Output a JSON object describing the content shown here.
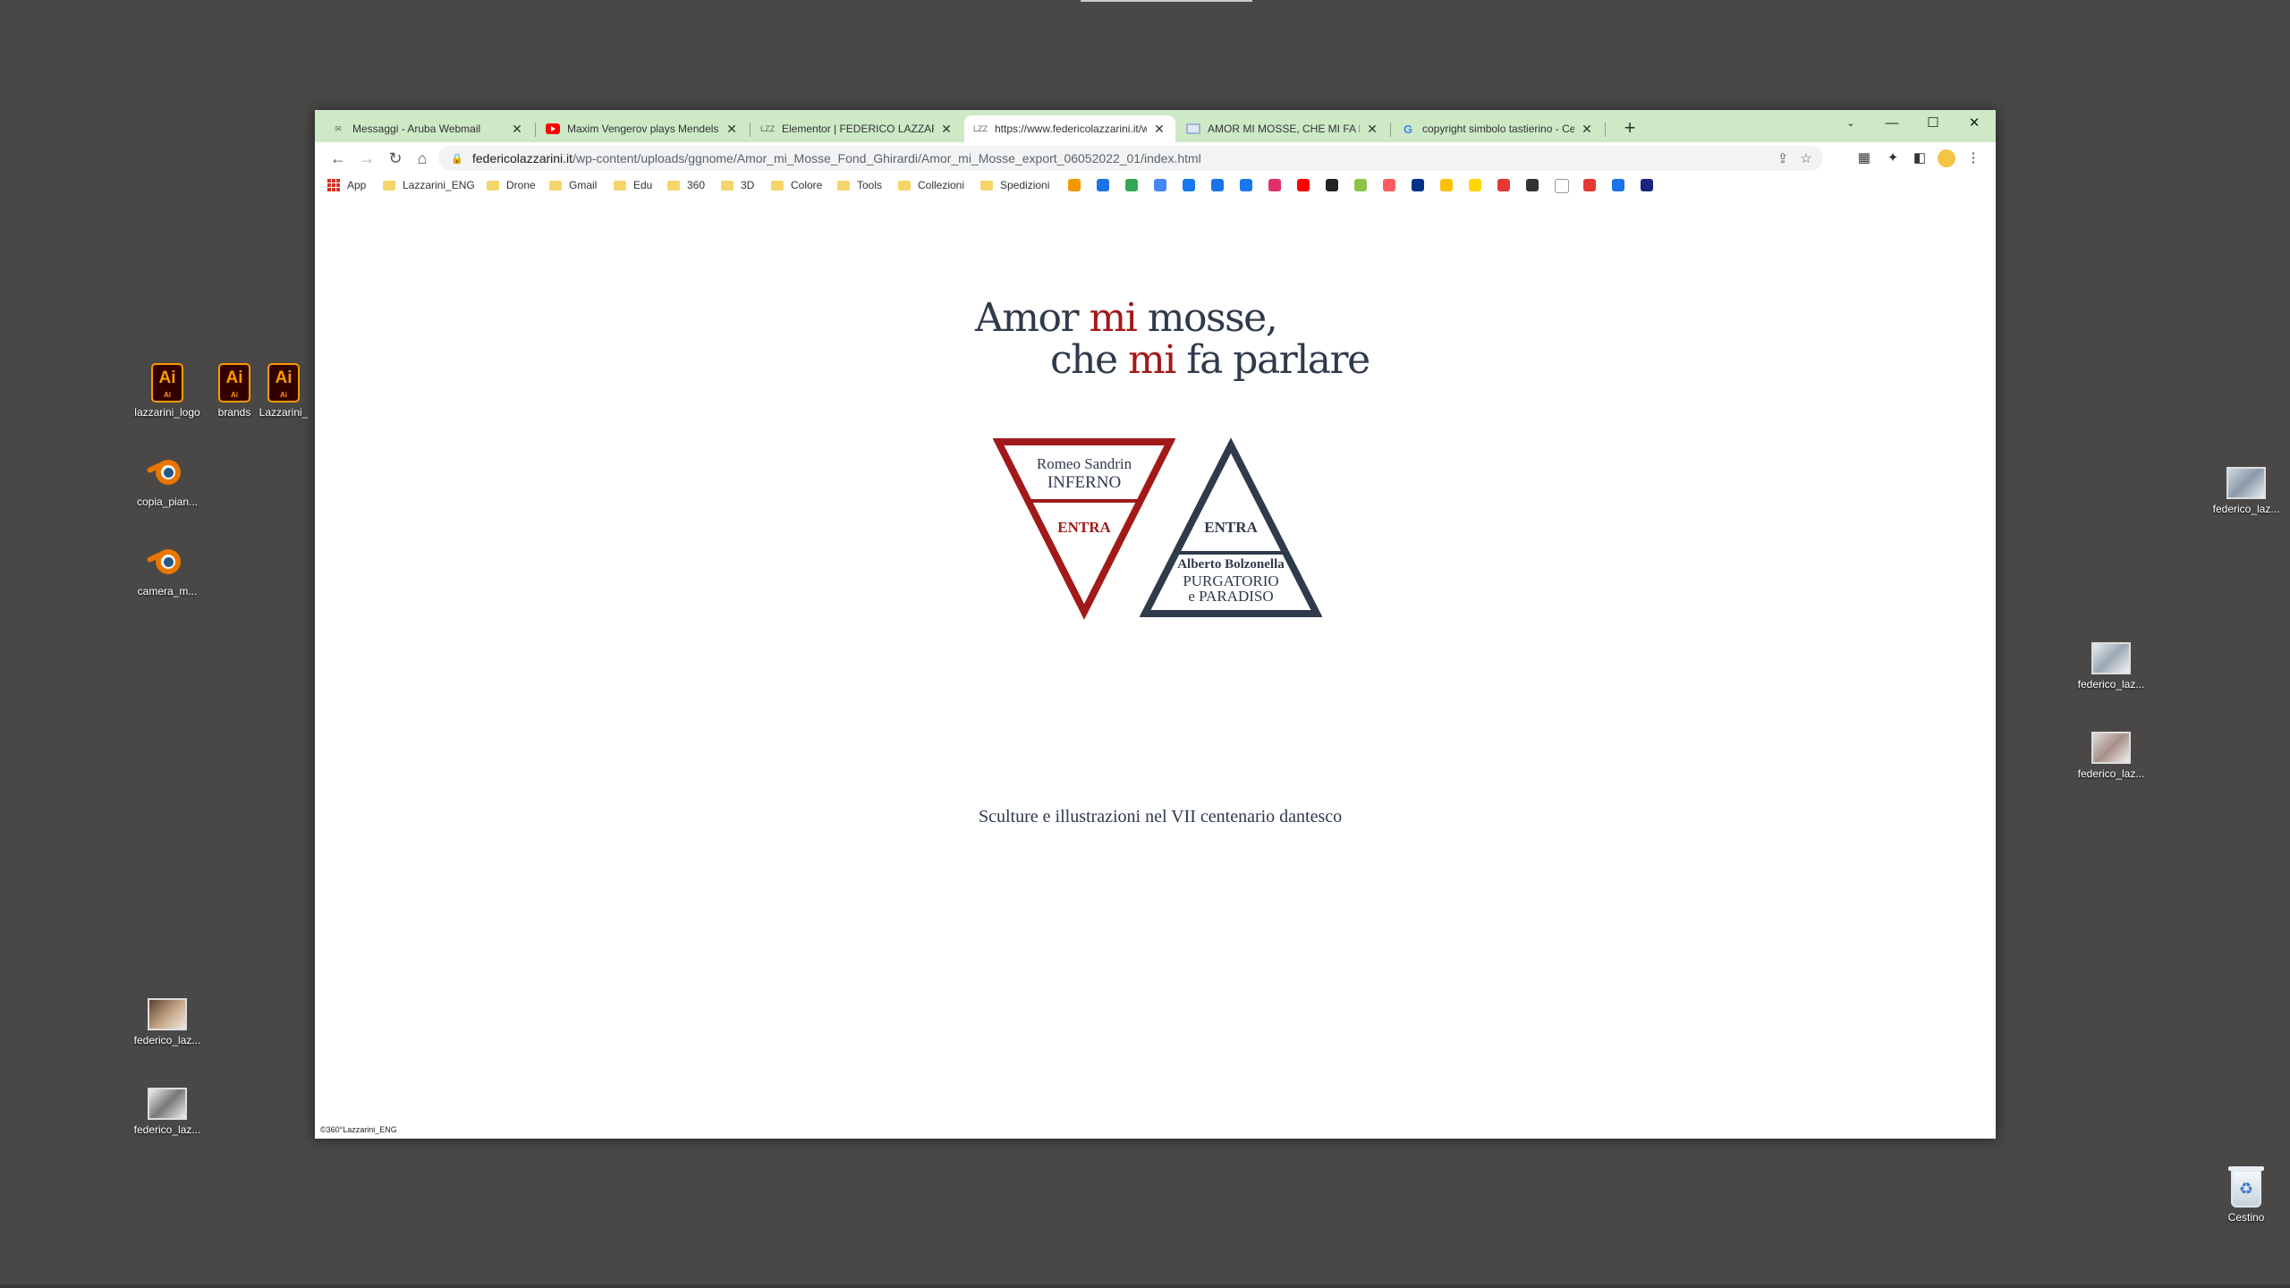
{
  "desktop": {
    "icons_left": [
      {
        "label": "lazzarini_logo",
        "type": "ai"
      },
      {
        "label": "brands",
        "type": "ai"
      },
      {
        "label": "Lazzarini_",
        "type": "ai"
      },
      {
        "label": "copia_pian...",
        "type": "blender"
      },
      {
        "label": "camera_m...",
        "type": "blender"
      },
      {
        "label": "federico_laz...",
        "type": "image"
      },
      {
        "label": "federico_laz...",
        "type": "image"
      }
    ],
    "icons_right": [
      {
        "label": "federico_laz...",
        "type": "image"
      },
      {
        "label": "federico_laz...",
        "type": "image"
      },
      {
        "label": "federico_laz...",
        "type": "image"
      }
    ],
    "recycle_bin": "Cestino",
    "ai_badge": "Ai",
    "ai_small": "Ai"
  },
  "browser": {
    "tabs": [
      {
        "title": "Messaggi - Aruba Webmail",
        "icon": "mail-icon"
      },
      {
        "title": "Maxim Vengerov plays Mendelsso",
        "icon": "youtube-icon"
      },
      {
        "title": "Elementor | FEDERICO LAZZARINI",
        "icon": "lzz-icon"
      },
      {
        "title": "https://www.federicolazzarini.it/w",
        "icon": "lzz-icon"
      },
      {
        "title": "AMOR MI MOSSE, CHE MI FA PA",
        "icon": "image-icon"
      },
      {
        "title": "copyright simbolo tastierino - Ce",
        "icon": "google-icon"
      }
    ],
    "url_host": "federicolazzarini.it",
    "url_path": "/wp-content/uploads/ggnome/Amor_mi_Mosse_Fond_Ghirardi/Amor_mi_Mosse_export_06052022_01/index.html",
    "bookmarks": [
      {
        "label": "App",
        "kind": "apps"
      },
      {
        "label": "Lazzarini_ENG",
        "kind": "folder"
      },
      {
        "label": "Drone",
        "kind": "folder"
      },
      {
        "label": "Gmail",
        "kind": "folder"
      },
      {
        "label": "Edu",
        "kind": "folder"
      },
      {
        "label": "360",
        "kind": "folder"
      },
      {
        "label": "3D",
        "kind": "folder"
      },
      {
        "label": "Colore",
        "kind": "folder"
      },
      {
        "label": "Tools",
        "kind": "folder"
      },
      {
        "label": "Collezioni",
        "kind": "folder"
      },
      {
        "label": "Spedizioni",
        "kind": "folder"
      }
    ],
    "bookmark_icon_colors": [
      "#f29900",
      "#1a73e8",
      "#34a853",
      "#4285f4",
      "#1877f2",
      "#1a73e8",
      "#1877f2",
      "#e1306c",
      "#ff0000",
      "#222222",
      "#8bc34a",
      "#ff5a5f",
      "#003087",
      "#ffc107",
      "#ffd600",
      "#e53935",
      "#333333",
      "#ffffff",
      "#e53935",
      "#1a73e8",
      "#1a237e"
    ]
  },
  "page": {
    "title_line1_a": "Amor ",
    "title_line1_b": "mi",
    "title_line1_c": " mosse,",
    "title_line2_a": "che ",
    "title_line2_b": "mi",
    "title_line2_c": " fa parlare",
    "inferno": {
      "author": "Romeo Sandrin",
      "name": "INFERNO",
      "cta": "ENTRA"
    },
    "purgatorio": {
      "cta": "ENTRA",
      "author": "Alberto Bolzonella",
      "name1": "PURGATORIO",
      "name2": "e PARADISO"
    },
    "subtitle": "Sculture e illustrazioni nel VII centenario dantesco",
    "footer": "©360°Lazzarini_ENG",
    "accent_red": "#a11a1a",
    "accent_navy": "#2f3a4b"
  }
}
